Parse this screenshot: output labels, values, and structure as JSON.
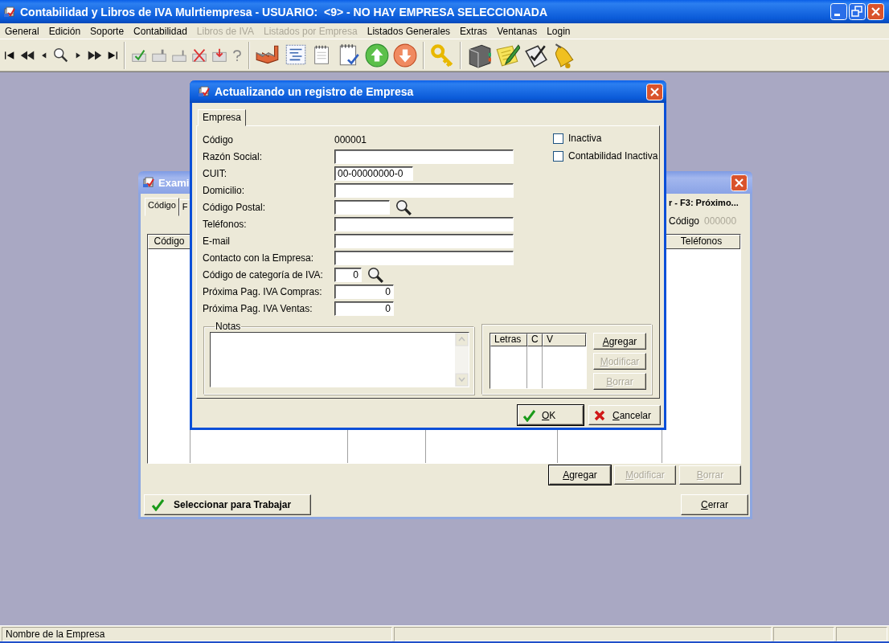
{
  "window": {
    "title": "Contabilidad y Libros de IVA Mulrtiempresa - USUARIO:  <9> - NO HAY EMPRESA SELECCIONADA"
  },
  "menu": [
    {
      "label": "General",
      "disabled": false
    },
    {
      "label": "Edición",
      "disabled": false
    },
    {
      "label": "Soporte",
      "disabled": false
    },
    {
      "label": "Contabilidad",
      "disabled": false
    },
    {
      "label": "Libros de IVA",
      "disabled": true
    },
    {
      "label": "Listados por Empresa",
      "disabled": true
    },
    {
      "label": "Listados Generales",
      "disabled": false
    },
    {
      "label": "Extras",
      "disabled": false
    },
    {
      "label": "Ventanas",
      "disabled": false
    },
    {
      "label": "Login",
      "disabled": false
    }
  ],
  "browse_window": {
    "title": "Exami",
    "tabs": [
      {
        "label": "Código",
        "selected": true
      },
      {
        "label": "F",
        "selected": false
      }
    ],
    "hint": "r - F3: Próximo...",
    "code_label": "Código",
    "code_value": "000000",
    "columns": [
      "Código",
      "Teléfonos"
    ],
    "buttons": [
      {
        "label": "Agregar",
        "disabled": false,
        "default": true
      },
      {
        "label": "Modificar",
        "disabled": true,
        "default": false
      },
      {
        "label": "Borrar",
        "disabled": true,
        "default": false
      }
    ],
    "select_button": "Seleccionar para Trabajar",
    "close_button": "Cerrar"
  },
  "edit_dialog": {
    "title": "Actualizando un registro de Empresa",
    "tabs": [
      {
        "label": "Empresa",
        "selected": true
      }
    ],
    "code_label": "Código",
    "code_value": "000001",
    "fields": [
      {
        "label": "Razón Social:",
        "kind": "wide"
      },
      {
        "label": "CUIT:",
        "kind": "cuit",
        "value": "00-00000000-0"
      },
      {
        "label": "Domicilio:",
        "kind": "wide"
      },
      {
        "label": "Código Postal:",
        "kind": "lookup"
      },
      {
        "label": "Teléfonos:",
        "kind": "wide"
      },
      {
        "label": "E-mail",
        "kind": "wide"
      },
      {
        "label": "Contacto con la Empresa:",
        "kind": "wide"
      },
      {
        "label": "Código de categoría de IVA:",
        "kind": "lookup_number",
        "value": "0"
      },
      {
        "label": "Próxima Pag. IVA Compras:",
        "kind": "number",
        "value": "0"
      },
      {
        "label": "Próxima Pag. IVA Ventas:",
        "kind": "number",
        "value": "0"
      }
    ],
    "checkboxes": [
      {
        "label": "Inactiva",
        "checked": false
      },
      {
        "label": "Contabilidad Inactiva",
        "checked": false
      }
    ],
    "notes_label": "Notas",
    "letters_columns": [
      "Letras",
      "C",
      "V"
    ],
    "letters_buttons": [
      {
        "label": "Agregar",
        "disabled": false
      },
      {
        "label": "Modificar",
        "disabled": true
      },
      {
        "label": "Borrar",
        "disabled": true
      }
    ],
    "ok_button": "OK",
    "cancel_button": "Cancelar"
  },
  "status_bar": {
    "text": "Nombre de la Empresa"
  }
}
